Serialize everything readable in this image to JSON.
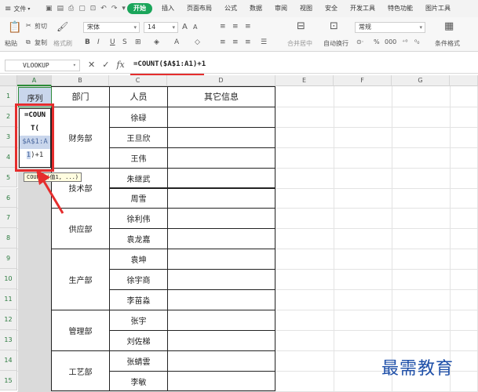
{
  "menubar": {
    "file_label": "文件",
    "tabs": [
      {
        "label": "开始",
        "active": true
      },
      {
        "label": "插入"
      },
      {
        "label": "页面布局"
      },
      {
        "label": "公式"
      },
      {
        "label": "数据"
      },
      {
        "label": "审阅"
      },
      {
        "label": "视图"
      },
      {
        "label": "安全"
      },
      {
        "label": "开发工具"
      },
      {
        "label": "特色功能"
      },
      {
        "label": "图片工具"
      }
    ]
  },
  "toolbar": {
    "cut": "剪切",
    "copy": "复制",
    "format_painter": "格式刷",
    "paste": "粘贴",
    "font_name": "宋体",
    "font_size": "14",
    "merge_center": "合并居中",
    "wrap_text": "自动换行",
    "number_format": "常规",
    "conditional_format": "条件格式",
    "percent_symbol": "%",
    "thousands_symbol": "000"
  },
  "formula_bar": {
    "name_box": "VLOOKUP",
    "formula": "=COUNT($A$1:A1)+1"
  },
  "columns": [
    "A",
    "B",
    "C",
    "D",
    "E",
    "F",
    "G"
  ],
  "rows": [
    "1",
    "2",
    "3",
    "4",
    "5",
    "6",
    "7",
    "8",
    "9",
    "10",
    "11",
    "12",
    "13",
    "14",
    "15"
  ],
  "table": {
    "headers": {
      "seq": "序列",
      "dept": "部门",
      "person": "人员",
      "other": "其它信息"
    },
    "departments": [
      "财务部",
      "技术部",
      "供应部",
      "生产部",
      "管理部",
      "工艺部"
    ],
    "people": [
      "徐碌",
      "王旦欣",
      "王伟",
      "朱继武",
      "周雪",
      "徐利伟",
      "袁龙嘉",
      "袁坤",
      "徐宇商",
      "李苗淼",
      "张宇",
      "刘佐梯",
      "张蜻雲",
      "李敏"
    ]
  },
  "edit_box": {
    "line1": "=COUN",
    "line2": "T(",
    "line3": "$A$1:A",
    "line4_ref": "1",
    "line4_rest": ")+1"
  },
  "tooltip": "COUNT (值1, ...)",
  "watermark": "最需教育",
  "colors": {
    "accent": "#1aa55a",
    "annotation": "#e52d2d",
    "selection": "#c9d6ec",
    "watermark": "#1e4fa8"
  }
}
